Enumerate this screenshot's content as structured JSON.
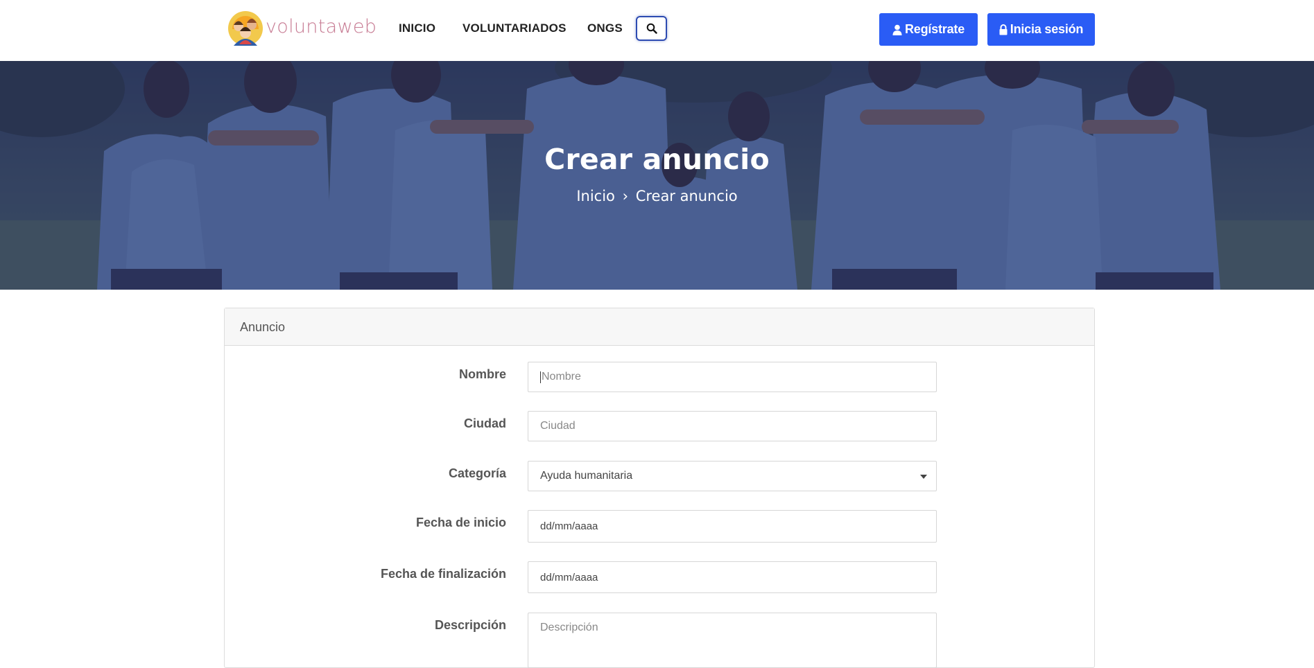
{
  "header": {
    "logo_text": "voluntaweb",
    "nav": [
      {
        "label": "INICIO"
      },
      {
        "label": "VOLUNTARIADOS"
      },
      {
        "label": "ONGS"
      }
    ],
    "register_label": "Regístrate",
    "login_label": "Inicia sesión"
  },
  "hero": {
    "title": "Crear anuncio",
    "breadcrumb": {
      "home": "Inicio",
      "separator": "›",
      "current": "Crear anuncio"
    }
  },
  "form": {
    "panel_title": "Anuncio",
    "fields": {
      "nombre": {
        "label": "Nombre",
        "placeholder": "Nombre"
      },
      "ciudad": {
        "label": "Ciudad",
        "placeholder": "Ciudad"
      },
      "categoria": {
        "label": "Categoría",
        "value": "Ayuda humanitaria"
      },
      "fecha_inicio": {
        "label": "Fecha de inicio",
        "value": "dd/mm/aaaa"
      },
      "fecha_fin": {
        "label": "Fecha de finalización",
        "value": "dd/mm/aaaa"
      },
      "descripcion": {
        "label": "Descripción",
        "placeholder": "Descripción"
      }
    }
  },
  "colors": {
    "primary": "#2a5cf5",
    "hero_overlay": "#2b3570",
    "logo_text": "#c77b93",
    "search_border": "#2d4bb1"
  },
  "icons": {
    "search": "search-icon",
    "user": "user-icon",
    "lock": "lock-icon",
    "dropdown": "caret-down-icon"
  }
}
